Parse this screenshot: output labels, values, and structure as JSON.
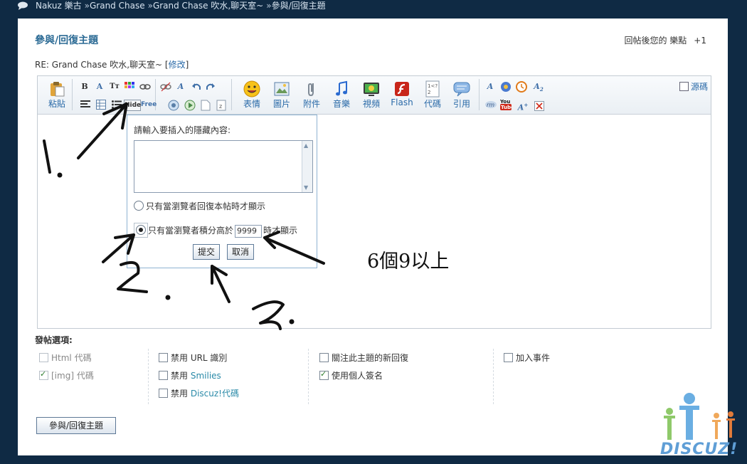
{
  "breadcrumb": {
    "items": [
      "Nakuz 樂古",
      "Grand Chase",
      "Grand Chase 吹水,聊天室~",
      "參與/回復主題"
    ],
    "separator": "»"
  },
  "header": {
    "title": "參與/回復主題",
    "credit_note": "回帖後您的 樂點",
    "credit_value": "+1"
  },
  "subject": {
    "text": "RE: Grand Chase 吹水,聊天室~",
    "edit_link": "修改"
  },
  "toolbar": {
    "paste_label": "粘貼",
    "smilies_label": "表情",
    "image_label": "圖片",
    "attach_label": "附件",
    "music_label": "音樂",
    "video_label": "視頻",
    "flash_label": "Flash",
    "code_label": "代碼",
    "quote_label": "引用",
    "hide_label": "Hide",
    "free_label": "Free",
    "source_label": "源碼"
  },
  "hide_popup": {
    "prompt": "請輸入要插入的隱藏內容:",
    "option_reply": "只有當瀏覽者回復本帖時才顯示",
    "option_score_prefix": "只有當瀏覽者積分高於",
    "score_value": "9999",
    "option_score_suffix": "時才顯示",
    "submit_label": "提交",
    "cancel_label": "取消"
  },
  "post_options": {
    "title": "發帖選項:",
    "html_code": "Html 代碼",
    "img_code": "[img] 代碼",
    "disable_url": "禁用 URL 識別",
    "disable_smilies_prefix": "禁用",
    "smilies_link": "Smilies",
    "disable_discuz_prefix": "禁用",
    "discuz_link": "Discuz!代碼",
    "notify_replies": "關注此主題的新回復",
    "use_signature": "使用個人簽名",
    "add_event": "加入事件"
  },
  "submit_button": "參與/回復主題",
  "annotation": "6個9以上",
  "watermark": "DISCUZ!",
  "colors": {
    "page_bg": "#0f2a44",
    "title_blue": "#2c6b95",
    "link_blue": "#2a6aa8"
  }
}
